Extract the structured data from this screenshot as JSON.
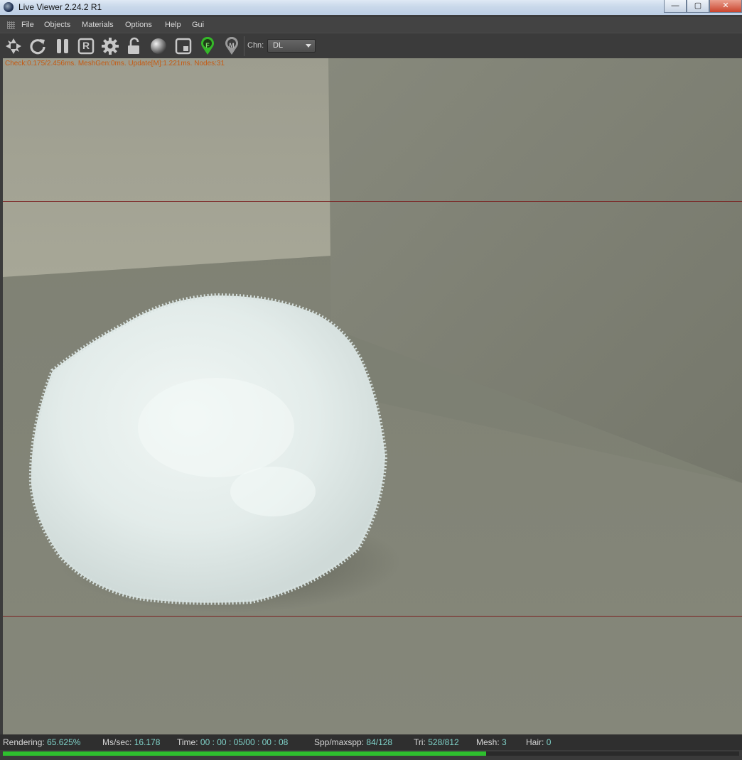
{
  "window": {
    "title": "Live Viewer 2.24.2 R1",
    "minimize": "—",
    "maximize": "▢",
    "close": "✕"
  },
  "menu": [
    "File",
    "Objects",
    "Materials",
    "Options",
    "Help",
    "Gui"
  ],
  "toolbar": {
    "channel_label": "Chn:",
    "channel_value": "DL",
    "region_button_letter": "R",
    "focus_pin_letter": "F",
    "material_pin_letter": "M"
  },
  "viewport": {
    "stats_text": "Check:0.175/2.456ms. MeshGen:0ms. Update[M]:1.221ms. Nodes:31"
  },
  "status": {
    "rendering_label": "Rendering:",
    "rendering_value": "65.625%",
    "mssec_label": "Ms/sec:",
    "mssec_value": "16.178",
    "time_label": "Time:",
    "time_value": "00 : 00 : 05/00 : 00 : 08",
    "spp_label": "Spp/maxspp:",
    "spp_value": "84/128",
    "tri_label": "Tri:",
    "tri_value": "528/812",
    "mesh_label": "Mesh:",
    "mesh_value": "3",
    "hair_label": "Hair:",
    "hair_value": "0",
    "progress_fraction": 0.656
  },
  "colors": {
    "accent_value": "#7fd1c8",
    "progress": "#2ec02e",
    "stats_text": "#c45a12",
    "guide_line": "#7a2020"
  }
}
